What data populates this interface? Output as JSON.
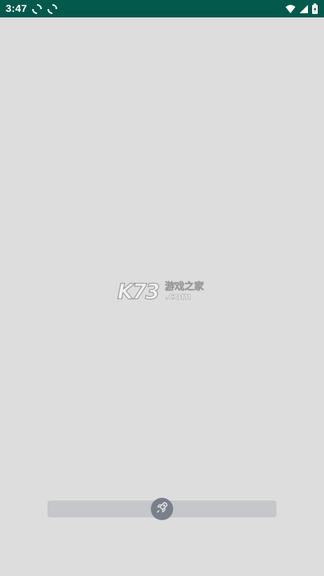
{
  "status_bar": {
    "time": "3:47",
    "bg_color": "#03594c",
    "icons": [
      "sync-icon",
      "sync-icon",
      "wifi-icon",
      "signal-icon",
      "battery-charging-icon"
    ]
  },
  "logo": {
    "mark": "K73",
    "chinese": "游戏之家",
    "domain": ".com"
  },
  "loading": {
    "progress": 0.5,
    "knob_icon": "rocket-icon"
  }
}
